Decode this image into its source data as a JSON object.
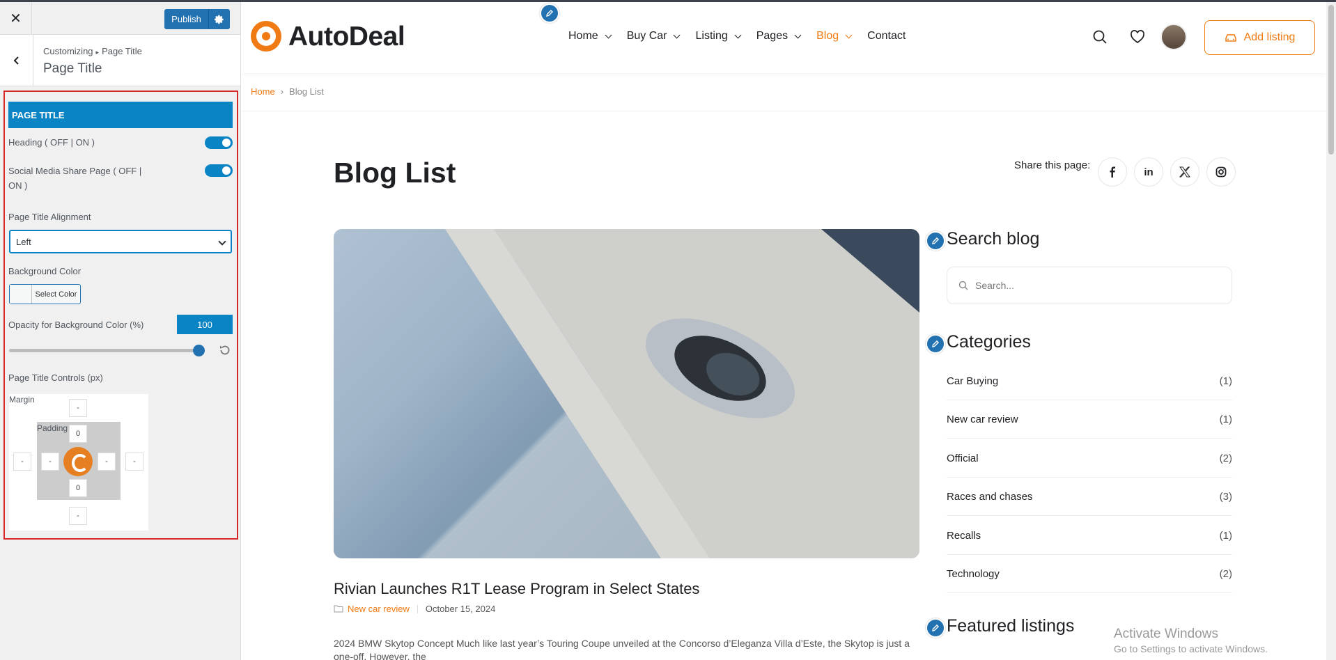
{
  "customizer": {
    "close_label": "✕",
    "publish_label": "Publish",
    "breadcrumb_root": "Customizing",
    "breadcrumb_sep": "▸",
    "breadcrumb_current": "Page Title",
    "section_title": "Page Title",
    "panel_header": "PAGE TITLE",
    "heading_toggle_label": "Heading ( OFF | ON )",
    "social_toggle_label_line1": "Social Media Share Page ( OFF |",
    "social_toggle_label_line2": "ON )",
    "alignment_label": "Page Title Alignment",
    "alignment_value": "Left",
    "bg_color_label": "Background Color",
    "select_color_label": "Select Color",
    "opacity_label": "Opacity for Background Color (%)",
    "opacity_value": "100",
    "opacity_fraction": 1.0,
    "controls_label": "Page Title Controls (px)",
    "margin_label": "Margin",
    "padding_label": "Padding",
    "margin_top": "-",
    "margin_left": "-",
    "margin_right": "-",
    "margin_bottom": "-",
    "padding_top": "0",
    "padding_left": "-",
    "padding_right": "-",
    "padding_bottom": "0",
    "accent_color": "#0a84c5",
    "highlight_border_color": "#d62828"
  },
  "site": {
    "logo_text": "AutoDeal",
    "brand_color": "#f07a13",
    "nav": [
      {
        "label": "Home",
        "dropdown": true
      },
      {
        "label": "Buy Car",
        "dropdown": true
      },
      {
        "label": "Listing",
        "dropdown": true
      },
      {
        "label": "Pages",
        "dropdown": true
      },
      {
        "label": "Blog",
        "dropdown": true,
        "active": true
      },
      {
        "label": "Contact",
        "dropdown": false
      }
    ],
    "add_listing_label": "Add listing",
    "breadcrumb_home": "Home",
    "breadcrumb_sep": "›",
    "breadcrumb_current": "Blog List",
    "page_title": "Blog List",
    "share_label": "Share this page:",
    "social_icons": [
      "facebook-icon",
      "linkedin-icon",
      "x-icon",
      "instagram-icon"
    ],
    "post": {
      "title": "Rivian Launches R1T Lease Program in Select States",
      "category": "New car review",
      "date": "October 15, 2024",
      "excerpt": "2024 BMW Skytop Concept Much like last year’s Touring Coupe unveiled at the Concorso d’Eleganza Villa d’Este, the Skytop is just a one-off. However, the"
    },
    "sidebar": {
      "search_title": "Search blog",
      "search_placeholder": "Search...",
      "categories_title": "Categories",
      "categories": [
        {
          "name": "Car Buying",
          "count": "(1)"
        },
        {
          "name": "New car review",
          "count": "(1)"
        },
        {
          "name": "Official",
          "count": "(2)"
        },
        {
          "name": "Races and chases",
          "count": "(3)"
        },
        {
          "name": "Recalls",
          "count": "(1)"
        },
        {
          "name": "Technology",
          "count": "(2)"
        }
      ],
      "featured_title": "Featured listings"
    }
  },
  "watermark": {
    "line1": "Activate Windows",
    "line2": "Go to Settings to activate Windows."
  }
}
